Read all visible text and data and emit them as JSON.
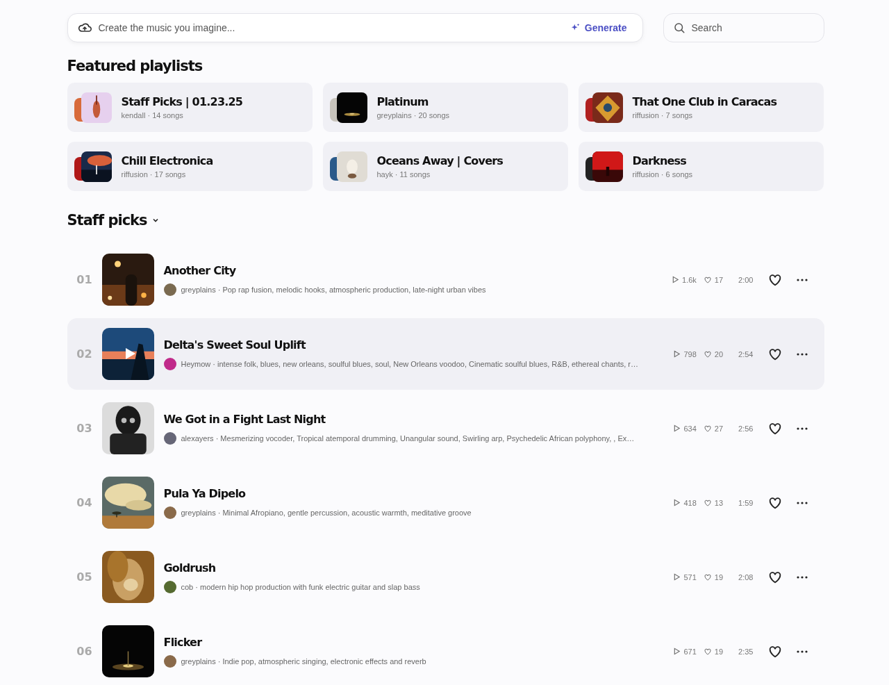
{
  "prompt": {
    "placeholder": "Create the music you imagine...",
    "button": "Generate"
  },
  "search": {
    "placeholder": "Search"
  },
  "featured": {
    "title": "Featured playlists",
    "playlists": [
      {
        "title": "Staff Picks | 01.23.25",
        "subtitle": "kendall · 14 songs"
      },
      {
        "title": "Platinum",
        "subtitle": "greyplains · 20 songs"
      },
      {
        "title": "That One Club in Caracas",
        "subtitle": "riffusion · 7 songs"
      },
      {
        "title": "Chill Electronica",
        "subtitle": "riffusion · 17 songs"
      },
      {
        "title": "Oceans Away | Covers",
        "subtitle": "hayk · 11 songs"
      },
      {
        "title": "Darkness",
        "subtitle": "riffusion · 6 songs"
      }
    ]
  },
  "staff_picks": {
    "title": "Staff picks",
    "tracks": [
      {
        "number": "01",
        "title": "Another City",
        "subtitle": "greyplains · Pop rap fusion, melodic hooks, atmospheric production, late-night urban vibes",
        "plays": "1.6k",
        "likes": "17",
        "duration": "2:00",
        "selected": false
      },
      {
        "number": "02",
        "title": "Delta's Sweet Soul Uplift",
        "subtitle": "Heymow · intense folk, blues, new orleans, soulful blues, soul, New Orleans voodoo, Cinematic soulful blues, R&B, ethereal chants, r…",
        "plays": "798",
        "likes": "20",
        "duration": "2:54",
        "selected": true
      },
      {
        "number": "03",
        "title": "We Got in a Fight Last Night",
        "subtitle": "alexayers · Mesmerizing vocoder, Tropical atemporal drumming, Unangular sound, Swirling arp, Psychedelic African polyphony, , Ex…",
        "plays": "634",
        "likes": "27",
        "duration": "2:56",
        "selected": false
      },
      {
        "number": "04",
        "title": "Pula Ya Dipelo",
        "subtitle": "greyplains · Minimal Afropiano, gentle percussion, acoustic warmth, meditative groove",
        "plays": "418",
        "likes": "13",
        "duration": "1:59",
        "selected": false
      },
      {
        "number": "05",
        "title": "Goldrush",
        "subtitle": "cob · modern hip hop production with funk electric guitar and slap bass",
        "plays": "571",
        "likes": "19",
        "duration": "2:08",
        "selected": false
      },
      {
        "number": "06",
        "title": "Flicker",
        "subtitle": "greyplains · Indie pop, atmospheric singing, electronic effects and reverb",
        "plays": "671",
        "likes": "19",
        "duration": "2:35",
        "selected": false
      }
    ]
  }
}
